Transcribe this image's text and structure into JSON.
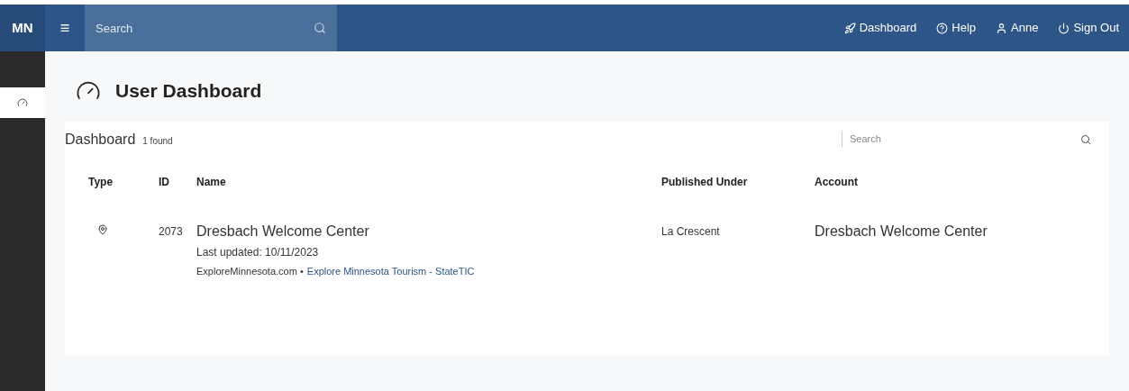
{
  "topbar": {
    "logo": "MN",
    "menu_icon": "≡",
    "search": {
      "placeholder": "Search"
    },
    "nav": [
      {
        "kind": "dashboard",
        "label": "Dashboard"
      },
      {
        "kind": "help",
        "label": "Help"
      },
      {
        "kind": "user",
        "label": "Anne"
      },
      {
        "kind": "signout",
        "label": "Sign Out"
      }
    ]
  },
  "page": {
    "title": "User Dashboard"
  },
  "list": {
    "title": "Dashboard",
    "count": "1 found",
    "search": {
      "placeholder": "Search"
    },
    "columns": [
      "Type",
      "ID",
      "Name",
      "Published Under",
      "Account"
    ],
    "rows": [
      {
        "kind": "location",
        "id": "2073",
        "name": "Dresbach Welcome Center",
        "updated": "Last updated: 10/11/2023",
        "site": "ExploreMinnesota.com •",
        "link": "Explore Minnesota Tourism - StateTIC",
        "published_under": "La Crescent",
        "account": "Dresbach Welcome Center"
      }
    ]
  }
}
